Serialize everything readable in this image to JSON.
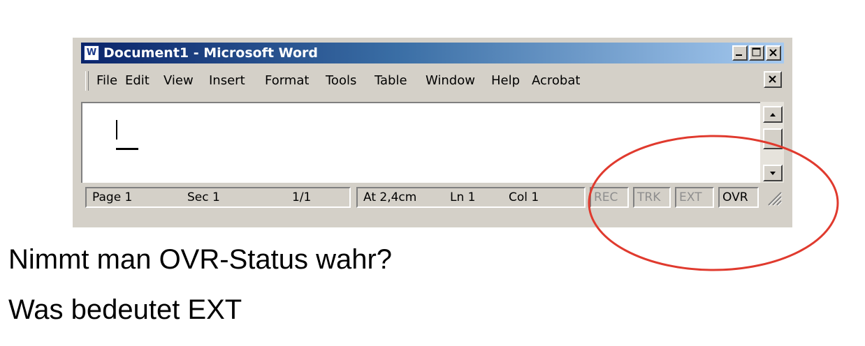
{
  "window": {
    "title": "Document1 - Microsoft Word",
    "app_icon_glyph": "W",
    "caption_buttons": [
      "minimize-icon",
      "maximize-icon",
      "close-icon"
    ]
  },
  "menubar": {
    "items": [
      "File",
      "Edit",
      "View",
      "Insert",
      "Format",
      "Tools",
      "Table",
      "Window",
      "Help",
      "Acrobat"
    ]
  },
  "statusbar": {
    "page": "Page 1",
    "section": "Sec 1",
    "pages": "1/1",
    "at": "At 2,4cm",
    "line": "Ln 1",
    "column": "Col 1",
    "rec": "REC",
    "trk": "TRK",
    "ext": "EXT",
    "ovr": "OVR"
  },
  "questions": {
    "q1": "Nimmt man OVR-Status wahr?",
    "q2": "Was bedeutet EXT"
  },
  "colors": {
    "title_gradient_start": "#0a246a",
    "title_gradient_end": "#a6caf0",
    "chrome": "#d4d0c8",
    "highlight_oval": "#e03a2e"
  }
}
